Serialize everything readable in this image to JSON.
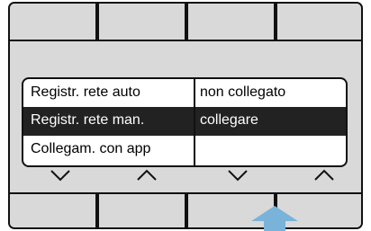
{
  "menu": {
    "rows": [
      {
        "label": "Registr. rete auto",
        "value": "non collegato",
        "selected": false
      },
      {
        "label": "Registr. rete man.",
        "value": "collegare",
        "selected": true
      },
      {
        "label": "Collegam. con app",
        "value": "",
        "selected": false
      }
    ]
  },
  "softkeys": [
    "chevron-down-icon",
    "chevron-up-icon",
    "chevron-down-icon",
    "chevron-up-icon"
  ],
  "colors": {
    "panel": "#d9d9d9",
    "selection": "#222222",
    "pointer_arrow": "#7ab3d9"
  },
  "pointer": {
    "icon": "arrow-up-icon",
    "target_bottom_button": 3
  }
}
